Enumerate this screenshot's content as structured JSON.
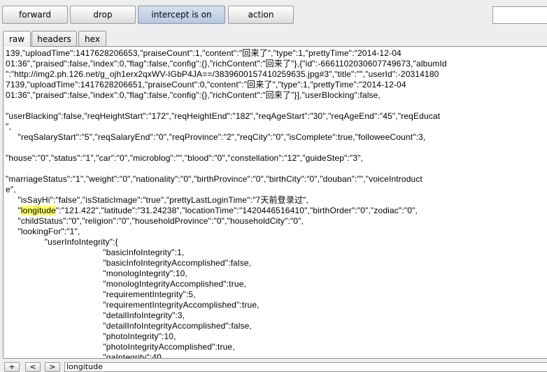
{
  "toolbar": {
    "forward_label": "forward",
    "drop_label": "drop",
    "intercept_label": "intercept is on",
    "action_label": "action",
    "filter_value": ""
  },
  "tabs": [
    {
      "label": "raw",
      "active": true
    },
    {
      "label": "headers",
      "active": false
    },
    {
      "label": "hex",
      "active": false
    }
  ],
  "body_lines": [
    {
      "t": "139,\"uploadTime\":1417628206653,\"praiseCount\":1,\"content\":\"回来了\",\"type\":1,\"prettyTime\":\"2014-12-04"
    },
    {
      "t": "01:36\",\"praised\":false,\"index\":0,\"flag\":false,\"config\":{},\"richContent\":\"回来了\"},{\"id\":-6661102030607749673,\"albumId"
    },
    {
      "t": "\":\"http://img2.ph.126.net/g_ojh1erx2qxWV-IGbP4JA==/3839600157410259635.jpg#3\",\"title\":\"\",\"userId\":-20314180"
    },
    {
      "t": "7139,\"uploadTime\":1417628206651,\"praiseCount\":0,\"content\":\"回来了\",\"type\":1,\"prettyTime\":\"2014-12-04"
    },
    {
      "t": "01:36\",\"praised\":false,\"index\":0,\"flag\":false,\"config\":{},\"richContent\":\"回来了\"}],\"userBlocking\":false,"
    },
    {
      "t": ""
    },
    {
      "t": "\"userBlacking\":false,\"reqHeightStart\":\"172\",\"reqHeightEnd\":\"182\",\"reqAgeStart\":\"30\",\"reqAgeEnd\":\"45\",\"reqEducat"
    },
    {
      "t": "\","
    },
    {
      "t": "     \"reqSalaryStart\":\"5\",\"reqSalaryEnd\":\"0\",\"reqProvince\":\"2\",\"reqCity\":\"0\",\"isComplete\":true,\"followeeCount\":3,"
    },
    {
      "t": ""
    },
    {
      "t": "\"house\":\"0\",\"status\":\"1\",\"car\":\"0\",\"microblog\":\"\",\"blood\":\"0\",\"constellation\":\"12\",\"guideStep\":\"3\","
    },
    {
      "t": ""
    },
    {
      "t": "\"marriageStatus\":\"1\",\"weight\":\"0\",\"nationality\":\"0\",\"birthProvince\":\"0\",\"birthCity\":\"0\",\"douban\":\"\",\"voiceIntroduct"
    },
    {
      "t": "e\","
    },
    {
      "t": "     \"isSayHi\":\"false\",\"isStaticImage\":\"true\",\"prettyLastLoginTime\":\"7天前登录过\","
    },
    {
      "pre": "     \"",
      "hl": "longitude",
      "post": "\":\"121.422\",\"latitude\":\"31.24238\",\"locationTime\":\"1420446516410\",\"birthOrder\":\"0\",\"zodiac\":\"0\","
    },
    {
      "t": "     \"childStatus\":\"0\",\"religion\":\"0\",\"householdProvince\":\"0\",\"householdCity\":\"0\","
    },
    {
      "t": "     \"lookingFor\":\"1\","
    },
    {
      "t": "                \"userInfoIntegrity\":{"
    },
    {
      "t": "                                        \"basicInfoIntegrity\":1,"
    },
    {
      "t": "                                        \"basicInfoIntegrityAccomplished\":false,"
    },
    {
      "t": "                                        \"monologIntegrity\":10,"
    },
    {
      "t": "                                        \"monologIntegrityAccomplished\":true,"
    },
    {
      "t": "                                        \"requirementIntegrity\":5,"
    },
    {
      "t": "                                        \"requirementIntegrityAccomplished\":true,"
    },
    {
      "t": "                                        \"detailInfoIntegrity\":3,"
    },
    {
      "t": "                                        \"detailInfoIntegrityAccomplished\":false,"
    },
    {
      "t": "                                        \"photoIntegrity\":10,"
    },
    {
      "t": "                                        \"photoIntegrityAccomplished\":true,"
    },
    {
      "t": "                                        \"qaIntegrity\":40,"
    }
  ],
  "search": {
    "plus_label": "+",
    "prev_label": "<",
    "next_label": ">",
    "value": "longitude"
  },
  "colors": {
    "highlight": "#ffff66",
    "intercept_on": "#c3d3e4"
  }
}
